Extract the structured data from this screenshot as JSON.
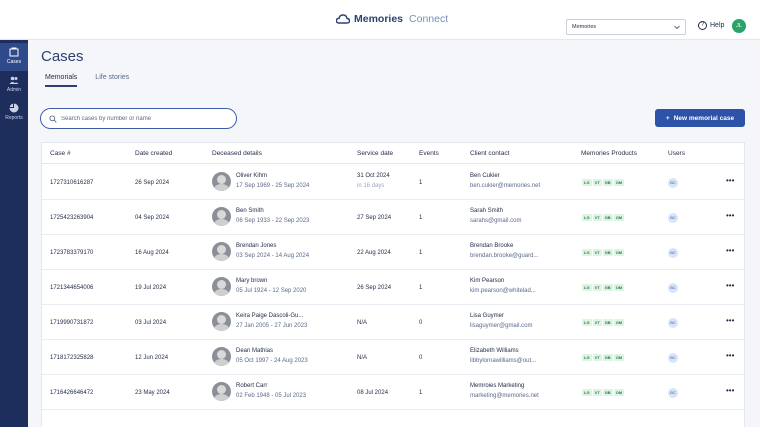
{
  "app": {
    "logo_main": "Memories",
    "logo_sub": "Connect",
    "org_selected": "Memories",
    "help_label": "Help",
    "user_initials": "JL"
  },
  "sidebar": {
    "items": [
      {
        "label": "Cases",
        "icon": "cases-icon",
        "active": true
      },
      {
        "label": "Admin",
        "icon": "admin-icon",
        "active": false
      },
      {
        "label": "Reports",
        "icon": "reports-icon",
        "active": false
      }
    ]
  },
  "page": {
    "title": "Cases",
    "tabs": [
      {
        "label": "Memorials",
        "active": true
      },
      {
        "label": "Life stories",
        "active": false
      }
    ]
  },
  "search": {
    "placeholder": "Search cases by number or name"
  },
  "actions": {
    "new_case_label": "New memorial case"
  },
  "table": {
    "columns": [
      "Case #",
      "Date created",
      "Deceased details",
      "Service date",
      "Events",
      "Client contact",
      "Memories Products",
      "Users"
    ],
    "rows": [
      {
        "case": "1727310616287",
        "created": "26 Sep 2024",
        "name": "Oliver Kihm",
        "dates": "17 Sep 1969 - 25 Sep 2024",
        "service": "31 Oct 2024",
        "service_sub": "in 16 days",
        "events": "1",
        "contact": "Ben Cukier",
        "email": "ben.cukier@memories.net",
        "products": [
          "LG",
          "VT",
          "GB",
          "OM"
        ],
        "user": "BC"
      },
      {
        "case": "1725423263904",
        "created": "04 Sep 2024",
        "name": "Ben Smith",
        "dates": "06 Sep 1933 - 22 Sep 2023",
        "service": "27 Sep 2024",
        "service_sub": "",
        "events": "1",
        "contact": "Sarah Smith",
        "email": "sarahs@gmail.com",
        "products": [
          "LG",
          "VT",
          "GB",
          "OM"
        ],
        "user": "BC"
      },
      {
        "case": "1723783379170",
        "created": "16 Aug 2024",
        "name": "Brendan Jones",
        "dates": "03 Sep 2024 - 14 Aug 2024",
        "service": "22 Aug 2024",
        "service_sub": "",
        "events": "1",
        "contact": "Brendan Brooke",
        "email": "brendan.brooke@guard...",
        "products": [
          "LG",
          "VT",
          "GB",
          "OM"
        ],
        "user": "BC"
      },
      {
        "case": "1721344654006",
        "created": "19 Jul 2024",
        "name": "Mary brown",
        "dates": "05 Jul 1924 - 12 Sep 2020",
        "service": "26 Sep 2024",
        "service_sub": "",
        "events": "1",
        "contact": "Kim Pearson",
        "email": "kim.pearson@whitelad...",
        "products": [
          "LG",
          "VT",
          "GB",
          "OM"
        ],
        "user": "BC"
      },
      {
        "case": "1719990731872",
        "created": "03 Jul 2024",
        "name": "Keira Paige Dascoli-Gu...",
        "dates": "27 Jan 2005 - 27 Jun 2023",
        "service": "N/A",
        "service_sub": "",
        "events": "0",
        "contact": "Lisa Guymer",
        "email": "lisaguymer@gmail.com",
        "products": [
          "LG",
          "VT",
          "GB",
          "OM"
        ],
        "user": "BC"
      },
      {
        "case": "1718172325828",
        "created": "12 Jun 2024",
        "name": "Dean Mathias",
        "dates": "05 Oct 1997 - 24 Aug 2023",
        "service": "N/A",
        "service_sub": "",
        "events": "0",
        "contact": "Elizabeth Williams",
        "email": "libbylornawilliams@out...",
        "products": [
          "LG",
          "VT",
          "GB",
          "OM"
        ],
        "user": "BC"
      },
      {
        "case": "1716426646472",
        "created": "23 May 2024",
        "name": "Robert Carr",
        "dates": "02 Feb 1948 - 05 Jul 2023",
        "service": "08 Jul 2024",
        "service_sub": "",
        "events": "1",
        "contact": "Memroies Marketing",
        "email": "marketing@memories.net",
        "products": [
          "LG",
          "VT",
          "GB",
          "OM"
        ],
        "user": "BC"
      }
    ]
  },
  "colors": {
    "brand": "#2c4170",
    "sidebar": "#1d2e5c",
    "primary_button": "#2c53a8",
    "product_chip": "#dff3e5",
    "user_avatar": "#29a36a"
  }
}
